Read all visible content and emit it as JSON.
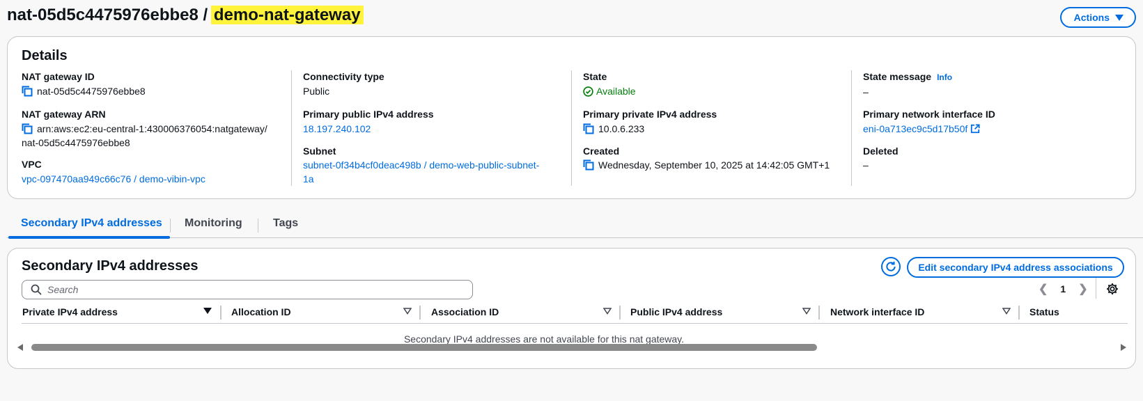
{
  "header": {
    "title_id": "nat-05d5c4475976ebbe8 / ",
    "title_name": "demo-nat-gateway",
    "actions_label": "Actions"
  },
  "details": {
    "title": "Details",
    "nat_id": {
      "label": "NAT gateway ID",
      "value": "nat-05d5c4475976ebbe8"
    },
    "nat_arn": {
      "label": "NAT gateway ARN",
      "value_line1": "arn:aws:ec2:eu-central-1:430006376054:natgateway/",
      "value_line2": "nat-05d5c4475976ebbe8"
    },
    "vpc": {
      "label": "VPC",
      "value": "vpc-097470aa949c66c76 / demo-vibin-vpc"
    },
    "connectivity": {
      "label": "Connectivity type",
      "value": "Public"
    },
    "public_ip": {
      "label": "Primary public IPv4 address",
      "value": "18.197.240.102"
    },
    "subnet": {
      "label": "Subnet",
      "value_line1": "subnet-0f34b4cf0deac498b / demo-web-public-subnet-",
      "value_line2": "1a"
    },
    "state": {
      "label": "State",
      "value": "Available"
    },
    "private_ip": {
      "label": "Primary private IPv4 address",
      "value": "10.0.6.233"
    },
    "created": {
      "label": "Created",
      "value": "Wednesday, September 10, 2025 at 14:42:05 GMT+1"
    },
    "state_message": {
      "label": "State message",
      "info": "Info",
      "value": "–"
    },
    "eni": {
      "label": "Primary network interface ID",
      "value": "eni-0a713ec9c5d17b50f"
    },
    "deleted": {
      "label": "Deleted",
      "value": "–"
    }
  },
  "tabs": [
    {
      "label": "Secondary IPv4 addresses",
      "active": true
    },
    {
      "label": "Monitoring",
      "active": false
    },
    {
      "label": "Tags",
      "active": false
    }
  ],
  "secondary": {
    "title": "Secondary IPv4 addresses",
    "edit_label": "Edit secondary IPv4 address associations",
    "search_placeholder": "Search",
    "page": "1",
    "columns": [
      "Private IPv4 address",
      "Allocation ID",
      "Association ID",
      "Public IPv4 address",
      "Network interface ID",
      "Status"
    ],
    "empty_message": "Secondary IPv4 addresses are not available for this nat gateway."
  },
  "colors": {
    "accent": "#006ce0",
    "success": "#037f0c",
    "highlight": "#fff33b"
  }
}
